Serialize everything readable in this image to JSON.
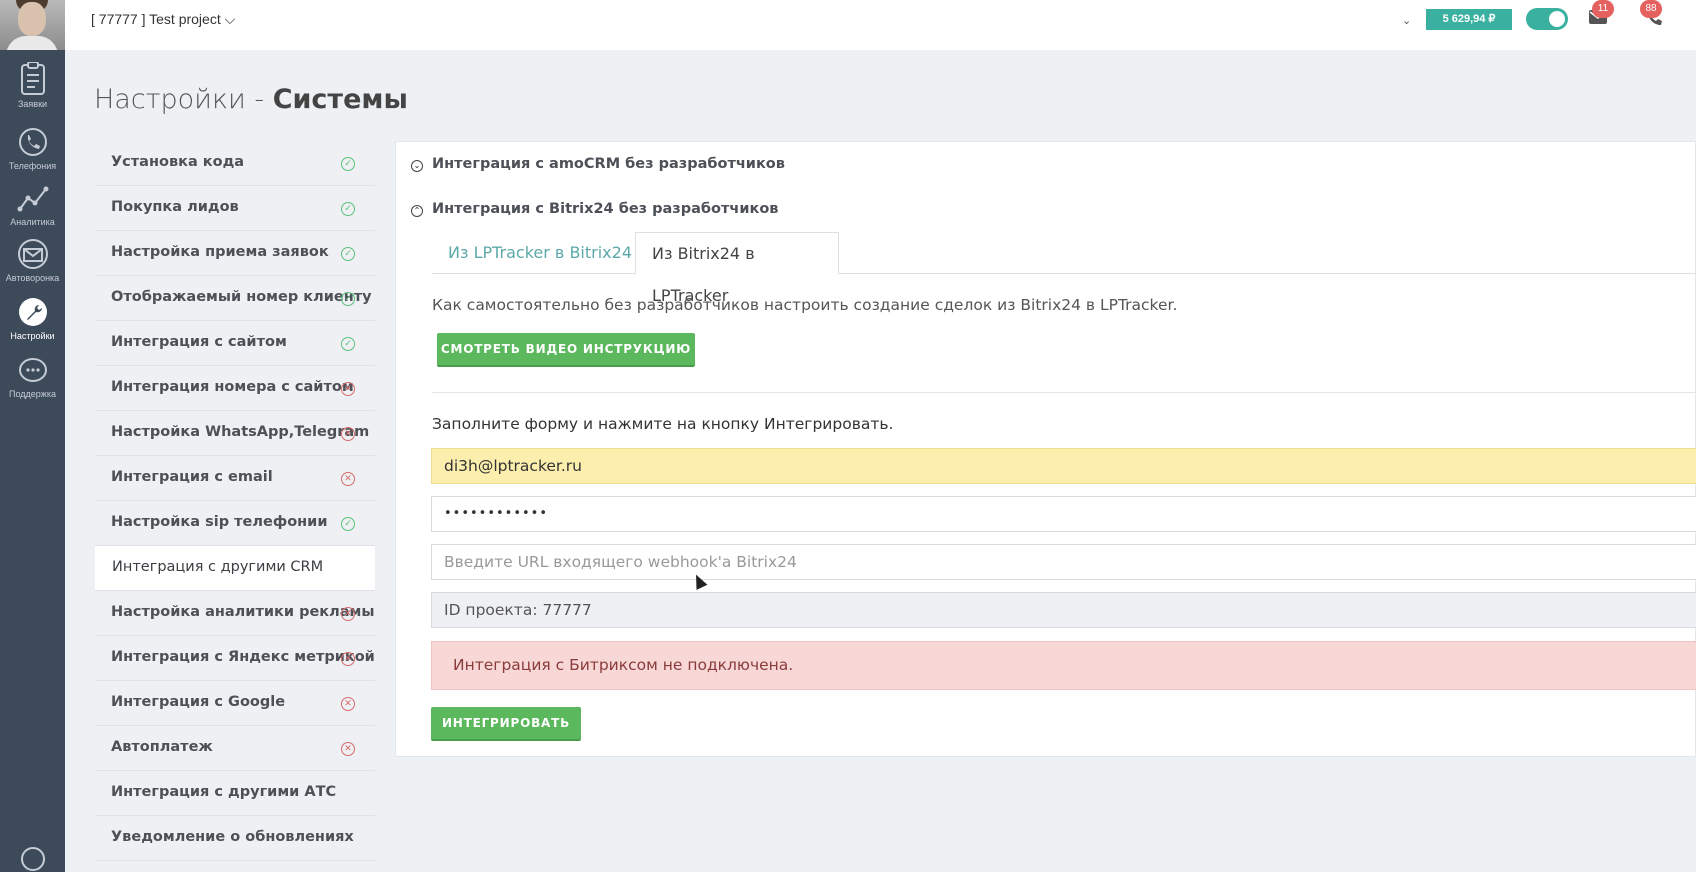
{
  "header": {
    "project": "[ 77777 ] Test project ⌵",
    "balance": "5 629,94 ₽",
    "mail_count": "11",
    "call_count": "88"
  },
  "rail": {
    "items": [
      {
        "label": "Заявки"
      },
      {
        "label": "Телефония"
      },
      {
        "label": "Аналитика"
      },
      {
        "label": "Автоворонка"
      },
      {
        "label": "Настройки"
      },
      {
        "label": "Поддержка"
      }
    ]
  },
  "page": {
    "title_light": "Настройки - ",
    "title_bold": "Системы"
  },
  "menu": {
    "items": [
      {
        "label": "Установка кода",
        "status": "ok"
      },
      {
        "label": "Покупка лидов",
        "status": "ok"
      },
      {
        "label": "Настройка приема заявок",
        "status": "ok"
      },
      {
        "label": "Отображаемый номер клиенту",
        "status": "ok"
      },
      {
        "label": "Интеграция с сайтом",
        "status": "ok"
      },
      {
        "label": "Интеграция номера с сайтом",
        "status": "no"
      },
      {
        "label": "Настройка WhatsApp,Telegram",
        "status": "no"
      },
      {
        "label": "Интеграция с email",
        "status": "no"
      },
      {
        "label": "Настройка sip телефонии",
        "status": "ok"
      },
      {
        "label": "Интеграция с другими CRM",
        "status": "none"
      },
      {
        "label": "Настройка аналитики рекламы",
        "status": "no"
      },
      {
        "label": "Интеграция с Яндекс метрикой",
        "status": "no"
      },
      {
        "label": "Интеграция с Google",
        "status": "no"
      },
      {
        "label": "Автоплатеж",
        "status": "no"
      },
      {
        "label": "Интеграция с другими АТС",
        "status": "none"
      },
      {
        "label": "Уведомление о обновлениях",
        "status": "none"
      }
    ]
  },
  "main": {
    "accordion": [
      {
        "label": "Интеграция с amoCRM без разработчиков"
      },
      {
        "label": "Интеграция с Bitrix24 без разработчиков"
      }
    ],
    "tabs": [
      {
        "label": "Из LPTracker в Bitrix24"
      },
      {
        "label": "Из Bitrix24 в LPTracker"
      }
    ],
    "description": "Как самостоятельно без разработчиков настроить создание сделок из Bitrix24 в LPTracker.",
    "video_button": "СМОТРЕТЬ ВИДЕО ИНСТРУКЦИЮ",
    "form_title": "Заполните форму и нажмите на кнопку Интегрировать.",
    "email_value": "di3h@lptracker.ru",
    "password_value": "••••••••••••",
    "webhook_placeholder": "Введите URL входящего webhook'a Bitrix24",
    "project_id": "ID проекта: 77777",
    "alert": "Интеграция с Битриксом не подключена.",
    "integrate_button": "ИНТЕГРИРОВАТЬ"
  },
  "colors": {
    "accent_teal": "#3ab0a1",
    "green_button": "#5cb85c",
    "rail_bg": "#3d4a5a",
    "alert_bg": "#f8d7d7"
  }
}
